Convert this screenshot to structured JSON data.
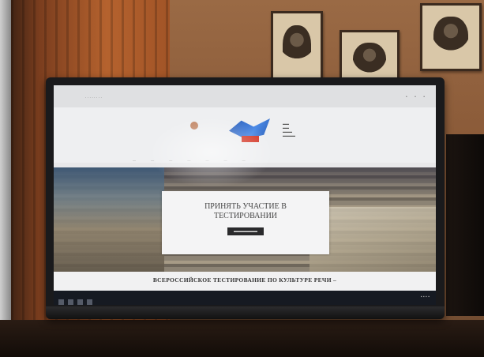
{
  "screen": {
    "hero_title_line1": "ПРИНЯТЬ УЧАСТИЕ В",
    "hero_title_line2": "ТЕСТИРОВАНИИ",
    "banner_text": "ВСЕРОССИЙСКОЕ ТЕСТИРОВАНИЕ ПО КУЛЬТУРЕ РЕЧИ –"
  }
}
